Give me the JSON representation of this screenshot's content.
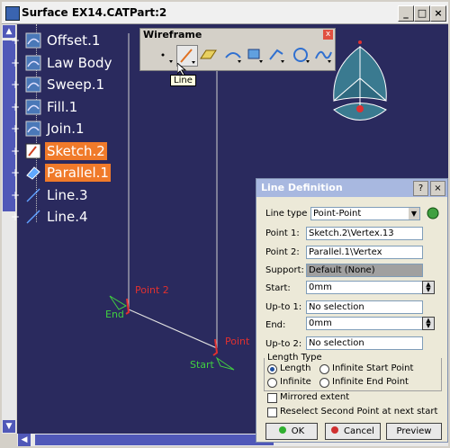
{
  "window": {
    "title": "Surface EX14.CATPart:2",
    "min": "_",
    "max": "□",
    "close": "×"
  },
  "tree": {
    "items": [
      {
        "label": "Offset.1",
        "icon": "offset-icon",
        "selected": false
      },
      {
        "label": "Law Body",
        "icon": "law-icon",
        "selected": false
      },
      {
        "label": "Sweep.1",
        "icon": "sweep-icon",
        "selected": false
      },
      {
        "label": "Fill.1",
        "icon": "fill-icon",
        "selected": false
      },
      {
        "label": "Join.1",
        "icon": "join-icon",
        "selected": false
      },
      {
        "label": "Sketch.2",
        "icon": "sketch-icon",
        "selected": true
      },
      {
        "label": "Parallel.1",
        "icon": "parallel-icon",
        "selected": true
      },
      {
        "label": "Line.3",
        "icon": "line-icon",
        "selected": false
      },
      {
        "label": "Line.4",
        "icon": "line-icon",
        "selected": false
      }
    ]
  },
  "toolbar": {
    "title": "Wireframe",
    "close": "x",
    "tooltip": "Line"
  },
  "canvas": {
    "point2_label": "Point 2",
    "end_label": "End",
    "point_label": "Point",
    "start_label": "Start"
  },
  "dialog": {
    "title": "Line Definition",
    "help": "?",
    "close": "×",
    "line_type_label": "Line type :",
    "line_type_value": "Point-Point",
    "point1_label": "Point 1:",
    "point1_value": "Sketch.2\\Vertex.13",
    "point2_label": "Point 2:",
    "point2_value": "Parallel.1\\Vertex",
    "support_label": "Support:",
    "support_value": "Default (None)",
    "start_label": "Start:",
    "start_value": "0mm",
    "upto1_label": "Up-to 1:",
    "upto1_value": "No selection",
    "end_label": "End:",
    "end_value": "0mm",
    "upto2_label": "Up-to 2:",
    "upto2_value": "No selection",
    "length_type_label": "Length Type",
    "opt_length": "Length",
    "opt_inf_start": "Infinite Start Point",
    "opt_infinite": "Infinite",
    "opt_inf_end": "Infinite End Point",
    "mirrored": "Mirrored extent",
    "reselect": "Reselect Second Point at next start",
    "ok": "OK",
    "cancel": "Cancel",
    "preview": "Preview"
  },
  "colors": {
    "canvas_bg": "#2a2a5e",
    "selected": "#f07a2a",
    "accent": "#5058b8",
    "point_red": "#e03030",
    "green_label": "#40d040"
  }
}
